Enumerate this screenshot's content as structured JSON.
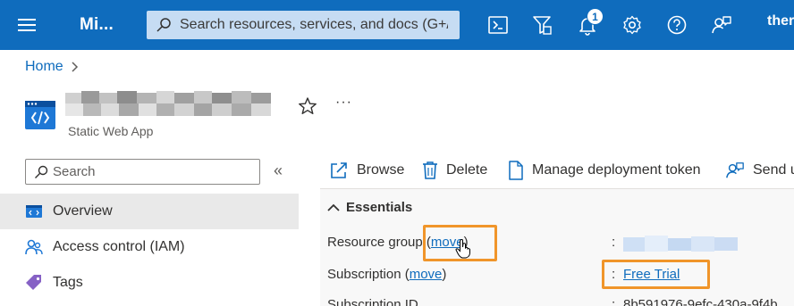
{
  "topbar": {
    "brand": "Mi...",
    "search_placeholder": "Search resources, services, and docs (G+/)",
    "notification_count": "1",
    "user_text": "ther",
    "icons": [
      "menu-icon",
      "search-icon",
      "cloud-shell-icon",
      "directory-filter-icon",
      "notifications-icon",
      "settings-icon",
      "help-icon",
      "feedback-icon"
    ]
  },
  "breadcrumb": {
    "home": "Home"
  },
  "resource": {
    "type_label": "Static Web App",
    "icon": "static-web-app-icon"
  },
  "sidebar": {
    "search_placeholder": "Search",
    "collapse_glyph": "«",
    "items": [
      {
        "label": "Overview",
        "icon": "overview-icon",
        "selected": true
      },
      {
        "label": "Access control (IAM)",
        "icon": "iam-icon",
        "selected": false
      },
      {
        "label": "Tags",
        "icon": "tag-icon",
        "selected": false
      }
    ]
  },
  "commands": {
    "browse": "Browse",
    "delete": "Delete",
    "manage_token": "Manage deployment token",
    "send": "Send u"
  },
  "essentials": {
    "title": "Essentials",
    "resource_group_label": "Resource group",
    "move_link": "move",
    "subscription_label": "Subscription",
    "subscription_value": "Free Trial",
    "subscription_id_label": "Subscription ID",
    "subscription_id_value": "8b591976-9efc-430a-9f4b",
    "colon": ":"
  },
  "colors": {
    "topbar": "#0f6cbd",
    "link": "#0f6cbd",
    "highlight": "#f0952a",
    "selected_nav": "#e9e9e9"
  }
}
